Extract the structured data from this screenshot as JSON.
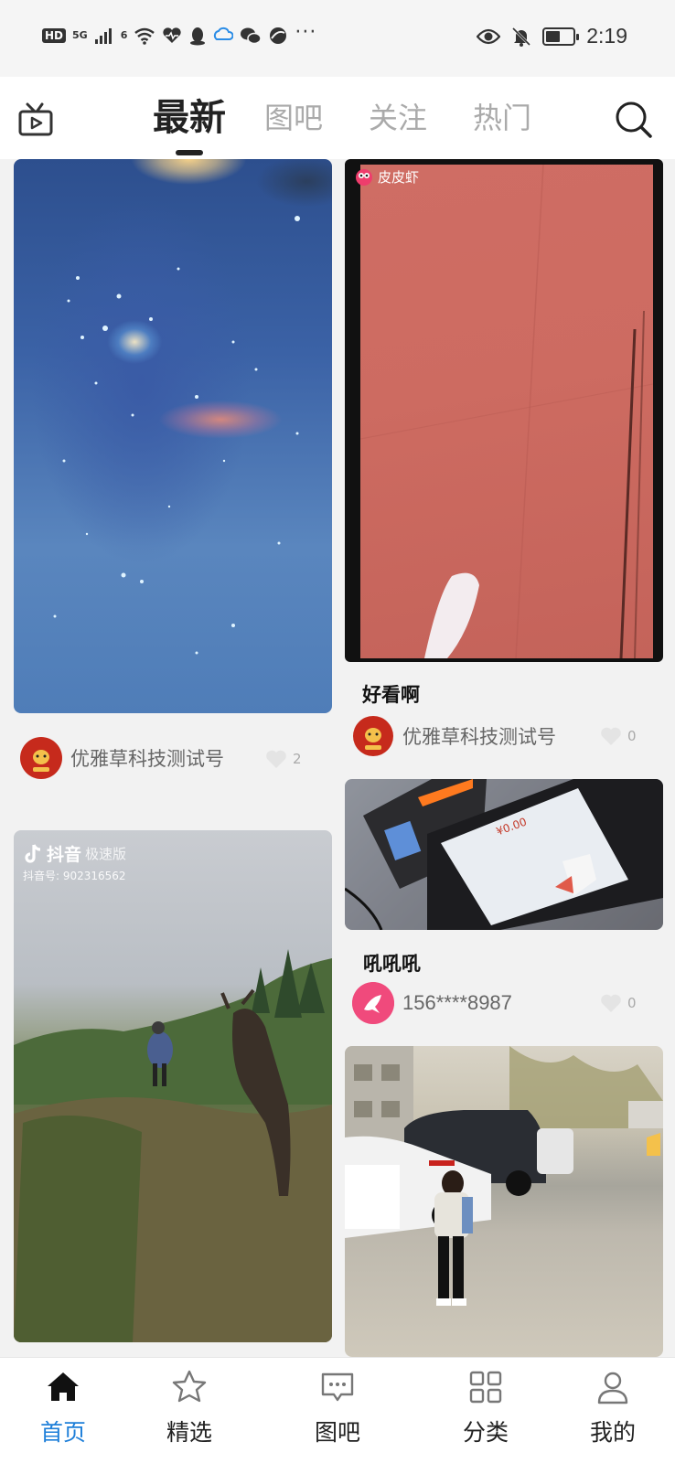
{
  "status_bar": {
    "hd": "HD",
    "signal": "5G",
    "wifi_sub": "6",
    "time": "2:19",
    "battery_level": 0.55
  },
  "top_nav": {
    "tabs": [
      {
        "label": "最新",
        "active": true
      },
      {
        "label": "图吧",
        "active": false
      },
      {
        "label": "关注",
        "active": false
      },
      {
        "label": "热门",
        "active": false
      }
    ]
  },
  "feed": {
    "left": [
      {
        "author": "优雅草科技测试号",
        "likes": "2"
      },
      {
        "watermark_brand": "抖音",
        "watermark_sub": "极速版",
        "watermark_id": "抖音号: 902316562"
      }
    ],
    "right": [
      {
        "watermark": "皮皮虾",
        "title": "好看啊",
        "author": "优雅草科技测试号",
        "likes": "0"
      },
      {
        "screen_text": "¥0.00",
        "title": "吼吼吼",
        "author": "156****8987",
        "likes": "0"
      },
      {}
    ]
  },
  "bottom_nav": {
    "items": [
      {
        "label": "首页",
        "icon": "home-icon",
        "active": true
      },
      {
        "label": "精选",
        "icon": "star-icon",
        "active": false
      },
      {
        "label": "图吧",
        "icon": "chat-bubble-icon",
        "active": false
      },
      {
        "label": "分类",
        "icon": "grid-icon",
        "active": false
      },
      {
        "label": "我的",
        "icon": "person-icon",
        "active": false
      }
    ]
  },
  "colors": {
    "accent": "#1e7fd9",
    "background": "#f2f2f2"
  }
}
